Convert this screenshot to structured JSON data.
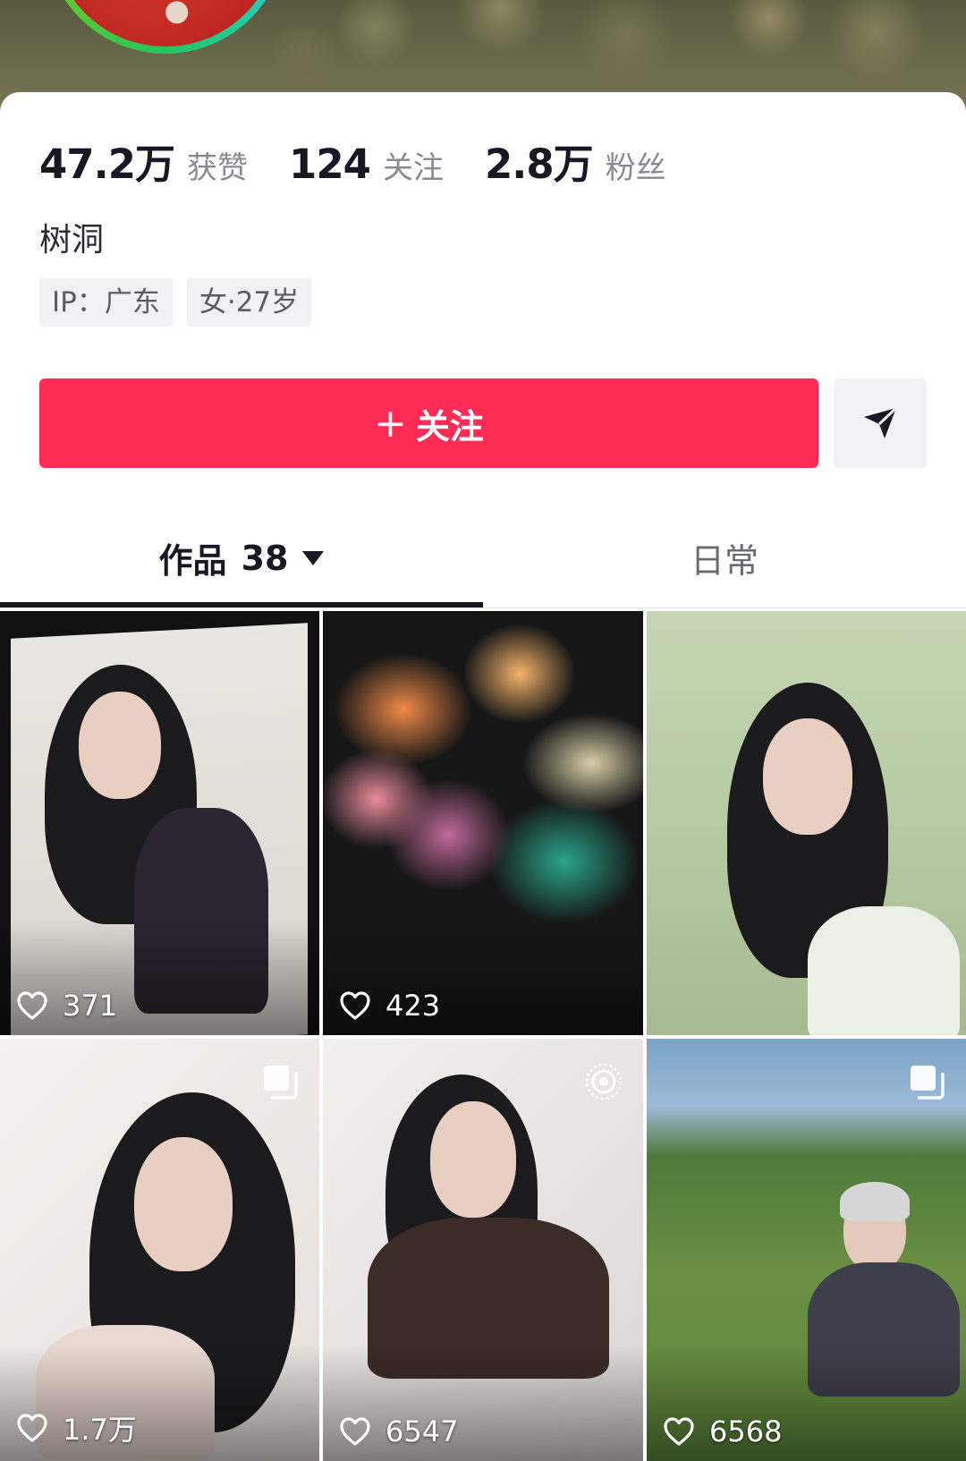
{
  "stats": [
    {
      "value": "47.2万",
      "label": "获赞"
    },
    {
      "value": "124",
      "label": "关注"
    },
    {
      "value": "2.8万",
      "label": "粉丝"
    }
  ],
  "bio": "树洞",
  "tags": [
    "IP：广东",
    "女·27岁"
  ],
  "follow_button": {
    "plus": "+",
    "label": "关注"
  },
  "tabs": {
    "works": {
      "label": "作品",
      "count": "38"
    },
    "daily": {
      "label": "日常"
    }
  },
  "videos": [
    {
      "likes": "371"
    },
    {
      "likes": "423"
    },
    {
      "likes": ""
    },
    {
      "likes": "1.7万",
      "badge": "gallery-icon"
    },
    {
      "likes": "6547",
      "badge": "live-photo-icon"
    },
    {
      "likes": "6568",
      "badge": "gallery-icon"
    }
  ],
  "colors": {
    "accent": "#fe2c55",
    "text": "#161823",
    "muted": "#8a8b91"
  }
}
